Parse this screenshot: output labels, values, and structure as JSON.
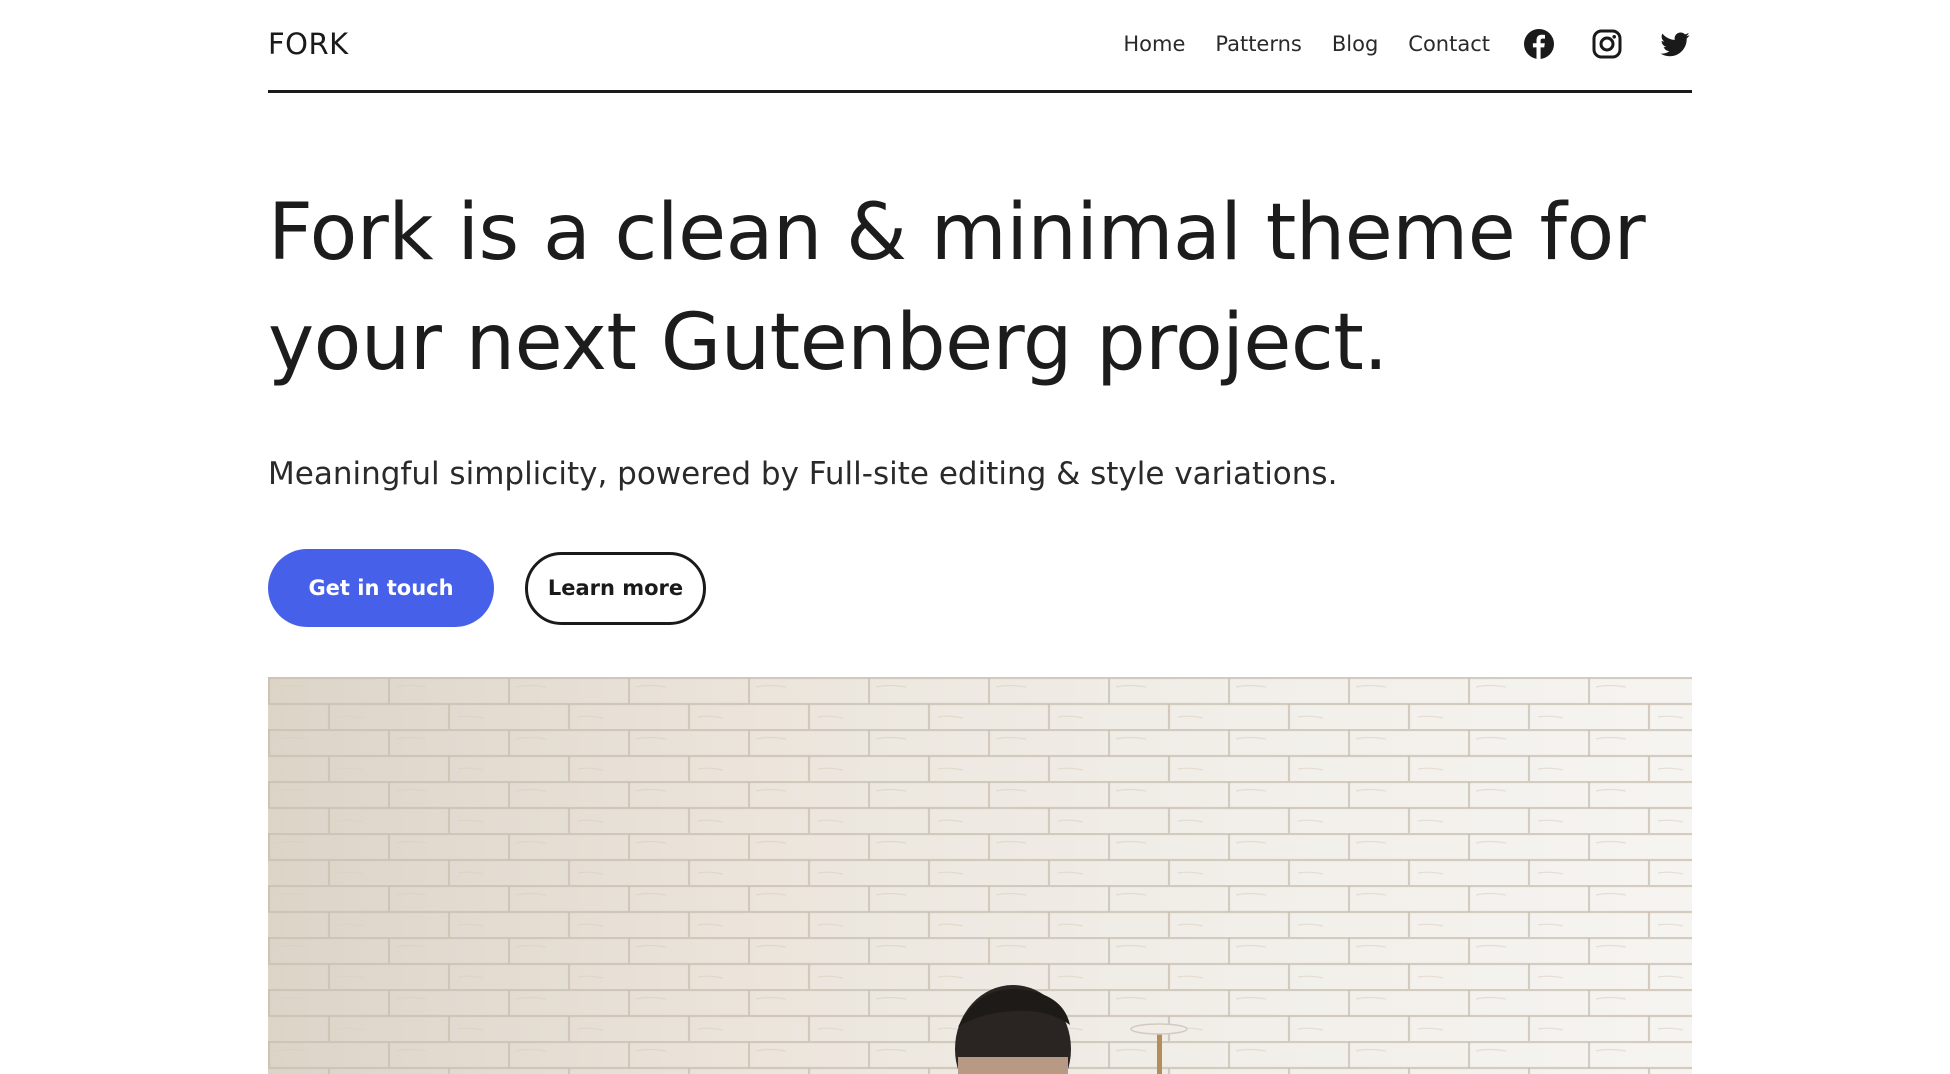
{
  "header": {
    "brand": "FORK",
    "nav": [
      {
        "label": "Home"
      },
      {
        "label": "Patterns"
      },
      {
        "label": "Blog"
      },
      {
        "label": "Contact"
      }
    ],
    "social": [
      {
        "icon": "facebook-icon"
      },
      {
        "icon": "instagram-icon"
      },
      {
        "icon": "twitter-icon"
      }
    ]
  },
  "hero": {
    "headline_line1": "Fork is a clean & minimal theme for",
    "headline_line2": "your next Gutenberg project.",
    "subheadline": "Meaningful simplicity, powered by Full-site editing & style variations.",
    "primary_button": "Get in touch",
    "secondary_button": "Learn more"
  },
  "image": {
    "subject": "white-brick-wall-photo"
  },
  "colors": {
    "accent": "#4660ea",
    "text": "#1a1a1a",
    "background": "#ffffff"
  }
}
